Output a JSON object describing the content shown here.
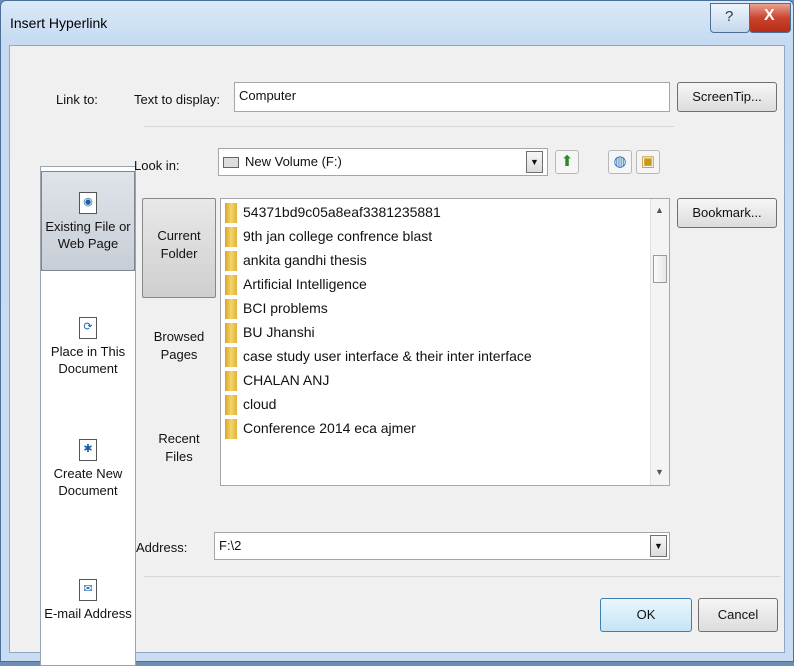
{
  "window": {
    "title": "Insert Hyperlink",
    "help_glyph": "?",
    "close_glyph": "X"
  },
  "link_to": {
    "label": "Link to:",
    "items": [
      {
        "label": "Existing File or Web Page",
        "icon": "web-page-icon",
        "selected": true
      },
      {
        "label": "Place in This Document",
        "icon": "document-place-icon",
        "selected": false
      },
      {
        "label": "Create New Document",
        "icon": "new-document-icon",
        "selected": false
      },
      {
        "label": "E-mail Address",
        "icon": "email-icon",
        "selected": false
      }
    ]
  },
  "text_to_display": {
    "label": "Text to display:",
    "value": "Computer"
  },
  "screentip_button": "ScreenTip...",
  "look_in": {
    "label": "Look in:",
    "value": "New Volume (F:)"
  },
  "places": [
    {
      "label": "Current Folder",
      "selected": true
    },
    {
      "label": "Browsed Pages",
      "selected": false
    },
    {
      "label": "Recent Files",
      "selected": false
    }
  ],
  "files": [
    "54371bd9c05a8eaf3381235881",
    "9th  jan college confrence blast",
    "ankita gandhi thesis",
    "Artificial Intelligence",
    "BCI problems",
    "BU Jhanshi",
    "case study user interface & their inter interface",
    "CHALAN ANJ",
    "cloud",
    "Conference 2014 eca ajmer"
  ],
  "bookmark_button": "Bookmark...",
  "address": {
    "label": "Address:",
    "value": "F:\\2"
  },
  "ok_button": "OK",
  "cancel_button": "Cancel",
  "colors": {
    "title_bar": "#c6dbf2",
    "close": "#c9432e",
    "folder": "#e8bf45",
    "selection": "#c8ced6"
  }
}
